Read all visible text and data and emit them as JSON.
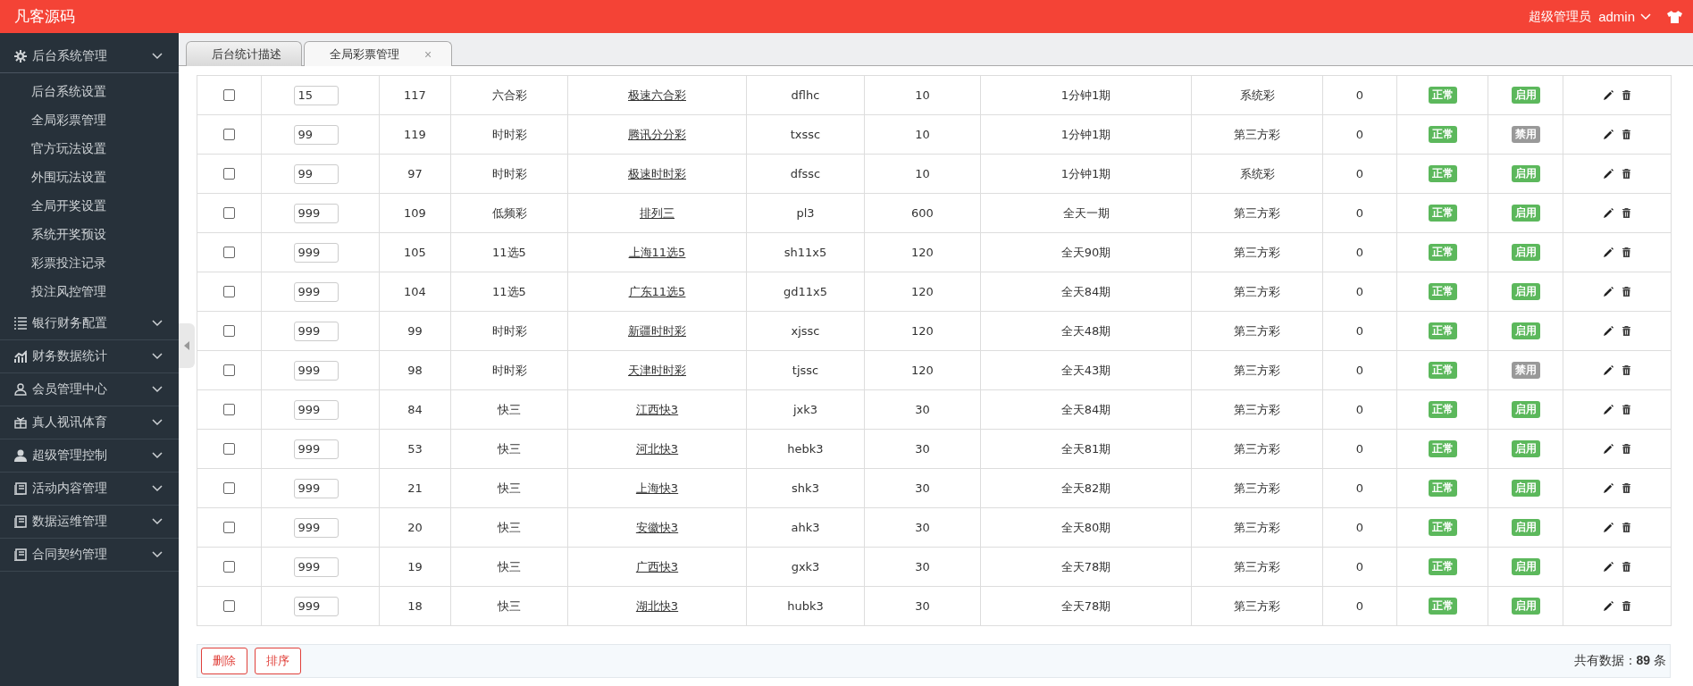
{
  "topbar": {
    "logo": "凡客源码",
    "role": "超级管理员",
    "user": "admin"
  },
  "sidebar": {
    "items": [
      {
        "label": "后台系统管理",
        "expanded": true,
        "children": [
          {
            "label": "后台系统设置"
          },
          {
            "label": "全局彩票管理"
          },
          {
            "label": "官方玩法设置"
          },
          {
            "label": "外围玩法设置"
          },
          {
            "label": "全局开奖设置"
          },
          {
            "label": "系统开奖预设"
          },
          {
            "label": "彩票投注记录"
          },
          {
            "label": "投注风控管理"
          }
        ]
      },
      {
        "label": "银行财务配置",
        "expanded": false
      },
      {
        "label": "财务数据统计",
        "expanded": false
      },
      {
        "label": "会员管理中心",
        "expanded": false
      },
      {
        "label": "真人视讯体育",
        "expanded": false
      },
      {
        "label": "超级管理控制",
        "expanded": false
      },
      {
        "label": "活动内容管理",
        "expanded": false
      },
      {
        "label": "数据运维管理",
        "expanded": false
      },
      {
        "label": "合同契约管理",
        "expanded": false
      }
    ]
  },
  "tabs": [
    {
      "label": "后台统计描述",
      "selected": false
    },
    {
      "label": "全局彩票管理",
      "selected": true,
      "close": "×"
    }
  ],
  "table": {
    "columns": [
      {
        "kind": "checkbox"
      },
      {
        "kind": "input"
      },
      {
        "kind": "text"
      },
      {
        "kind": "text"
      },
      {
        "kind": "link"
      },
      {
        "kind": "text"
      },
      {
        "kind": "text"
      },
      {
        "kind": "text"
      },
      {
        "kind": "text"
      },
      {
        "kind": "text"
      },
      {
        "kind": "badge"
      },
      {
        "kind": "toggle"
      },
      {
        "kind": "actions"
      }
    ],
    "rows": [
      {
        "checked": false,
        "enabled": true,
        "cells": [
          "15",
          "117",
          "六合彩",
          "极速六合彩",
          "dflhc",
          "10",
          "1分钟1期",
          "系统彩",
          "0",
          "正常",
          "启用"
        ]
      },
      {
        "checked": false,
        "enabled": false,
        "cells": [
          "99",
          "119",
          "时时彩",
          "腾讯分分彩",
          "txssc",
          "10",
          "1分钟1期",
          "第三方彩",
          "0",
          "正常",
          "禁用"
        ]
      },
      {
        "checked": false,
        "enabled": true,
        "cells": [
          "99",
          "97",
          "时时彩",
          "极速时时彩",
          "dfssc",
          "10",
          "1分钟1期",
          "系统彩",
          "0",
          "正常",
          "启用"
        ]
      },
      {
        "checked": false,
        "enabled": true,
        "cells": [
          "999",
          "109",
          "低频彩",
          "排列三",
          "pl3",
          "600",
          "全天一期",
          "第三方彩",
          "0",
          "正常",
          "启用"
        ]
      },
      {
        "checked": false,
        "enabled": true,
        "cells": [
          "999",
          "105",
          "11选5",
          "上海11选5",
          "sh11x5",
          "120",
          "全天90期",
          "第三方彩",
          "0",
          "正常",
          "启用"
        ]
      },
      {
        "checked": false,
        "enabled": true,
        "cells": [
          "999",
          "104",
          "11选5",
          "广东11选5",
          "gd11x5",
          "120",
          "全天84期",
          "第三方彩",
          "0",
          "正常",
          "启用"
        ]
      },
      {
        "checked": false,
        "enabled": true,
        "cells": [
          "999",
          "99",
          "时时彩",
          "新疆时时彩",
          "xjssc",
          "120",
          "全天48期",
          "第三方彩",
          "0",
          "正常",
          "启用"
        ]
      },
      {
        "checked": false,
        "enabled": false,
        "cells": [
          "999",
          "98",
          "时时彩",
          "天津时时彩",
          "tjssc",
          "120",
          "全天43期",
          "第三方彩",
          "0",
          "正常",
          "禁用"
        ]
      },
      {
        "checked": false,
        "enabled": true,
        "cells": [
          "999",
          "84",
          "快三",
          "江西快3",
          "jxk3",
          "30",
          "全天84期",
          "第三方彩",
          "0",
          "正常",
          "启用"
        ]
      },
      {
        "checked": false,
        "enabled": true,
        "cells": [
          "999",
          "53",
          "快三",
          "河北快3",
          "hebk3",
          "30",
          "全天81期",
          "第三方彩",
          "0",
          "正常",
          "启用"
        ]
      },
      {
        "checked": false,
        "enabled": true,
        "cells": [
          "999",
          "21",
          "快三",
          "上海快3",
          "shk3",
          "30",
          "全天82期",
          "第三方彩",
          "0",
          "正常",
          "启用"
        ]
      },
      {
        "checked": false,
        "enabled": true,
        "cells": [
          "999",
          "20",
          "快三",
          "安徽快3",
          "ahk3",
          "30",
          "全天80期",
          "第三方彩",
          "0",
          "正常",
          "启用"
        ]
      },
      {
        "checked": false,
        "enabled": true,
        "cells": [
          "999",
          "19",
          "快三",
          "广西快3",
          "gxk3",
          "30",
          "全天78期",
          "第三方彩",
          "0",
          "正常",
          "启用"
        ]
      },
      {
        "checked": false,
        "enabled": true,
        "cells": [
          "999",
          "18",
          "快三",
          "湖北快3",
          "hubk3",
          "30",
          "全天78期",
          "第三方彩",
          "0",
          "正常",
          "启用"
        ]
      }
    ]
  },
  "footer": {
    "buttons": [
      "删除",
      "排序"
    ],
    "total": "共有数据：**89** 条"
  }
}
